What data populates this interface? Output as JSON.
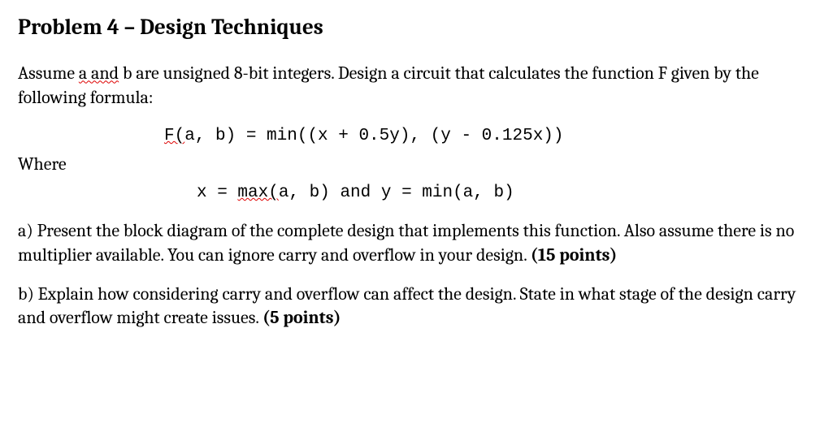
{
  "title": "Problem 4 – Design Techniques",
  "intro1": "Assume ",
  "intro_spell": "a and",
  "intro2": " b are unsigned 8-bit integers. Design a circuit that calculates the function F given by the following formula:",
  "formula": {
    "f_spell": "F(",
    "f_rest": "a, b) = min((x + 0.5y), (y - 0.125x))",
    "where": "Where",
    "xy_pre": "x = ",
    "xy_spell": "max(",
    "xy_rest": "a, b) and y = min(a, b)"
  },
  "parta": "a) Present the block diagram of the complete design that implements this function. Also assume there is no multiplier available. You can ignore carry and overflow in your design. ",
  "parta_pts": "(15 points)",
  "partb": "b) Explain how considering carry and overflow can affect the design. State in what stage of the design carry and overflow might create issues. ",
  "partb_pts": "(5 points)"
}
